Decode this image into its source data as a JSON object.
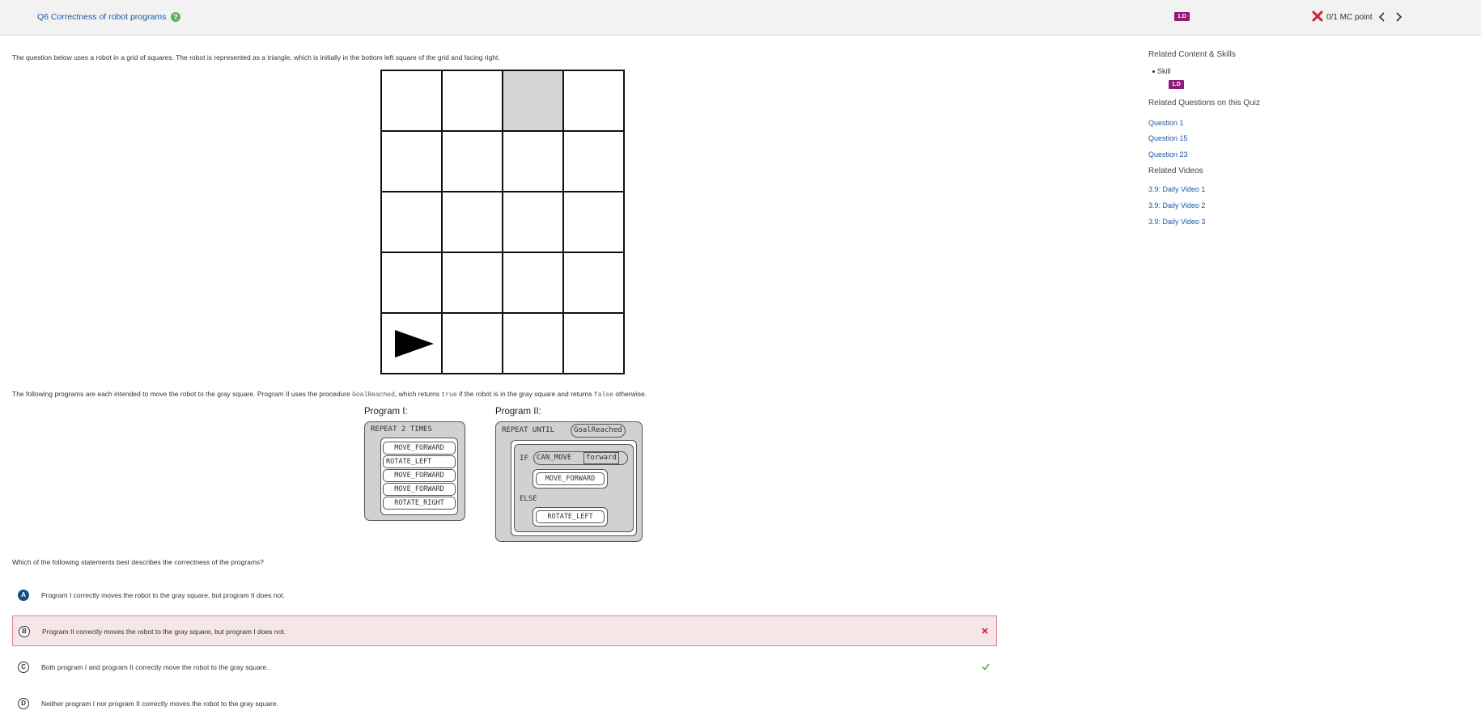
{
  "header": {
    "title": "Q6 Correctness of robot programs",
    "help_glyph": "?",
    "skill_badge": "1.D",
    "score": "0/1 MC point"
  },
  "intro": "The question below uses a robot in a grid of squares. The robot is represented as a triangle, which is initially in the bottom left square of the grid and facing right.",
  "grid": {
    "rows": 5,
    "cols": 4,
    "gray_cell": [
      0,
      2
    ],
    "robot_cell": [
      4,
      0
    ],
    "robot_direction": "right"
  },
  "para2": {
    "before": "The following programs are each intended to move the robot to the gray square. Program II uses the procedure",
    "proc": "GoalReached",
    "mid1": ", which returns",
    "true_kw": "true",
    "mid2": "if the robot is in the gray square and returns",
    "false_kw": "false",
    "after": "otherwise."
  },
  "program1": {
    "label": "Program I:",
    "header": "REPEAT 2 TIMES",
    "commands": [
      "MOVE_FORWARD",
      "ROTATE_LEFT",
      "MOVE_FORWARD",
      "MOVE_FORWARD",
      "ROTATE_RIGHT"
    ]
  },
  "program2": {
    "label": "Program II:",
    "repeat_kw": "REPEAT UNTIL",
    "condition": "GoalReached",
    "if_kw": "IF",
    "can_move": "CAN_MOVE",
    "direction": "forward",
    "then_cmd": "MOVE_FORWARD",
    "else_kw": "ELSE",
    "else_cmd": "ROTATE_LEFT"
  },
  "question": "Which of the following statements best describes the correctness of the programs?",
  "choices": [
    {
      "letter": "A",
      "text": "Program I correctly moves the robot to the gray square, but program II does not."
    },
    {
      "letter": "B",
      "text": "Program II correctly moves the robot to the gray square, but program I does not."
    },
    {
      "letter": "C",
      "text": "Both program I and program II correctly move the robot to the gray square."
    },
    {
      "letter": "D",
      "text": "Neither program I nor program II correctly moves the robot to the gray square."
    }
  ],
  "sidebar": {
    "related_heading": "Related Content & Skills",
    "skill_label": "Skill",
    "skill_badge": "1.D",
    "questions_heading": "Related Questions on this Quiz",
    "questions": [
      "Question 1",
      "Question 15",
      "Question 23"
    ],
    "videos_heading": "Related Videos",
    "videos": [
      "3.9: Daily Video 1",
      "3.9: Daily Video 2",
      "3.9: Daily Video 3"
    ]
  },
  "colors": {
    "accent_link": "#1a5aa6",
    "badge": "#8e1a7a",
    "wrong_bg": "#f5e6e8",
    "wrong_border": "#e08090",
    "correct": "#5aa64f",
    "incorrect": "#cc1f2f"
  }
}
